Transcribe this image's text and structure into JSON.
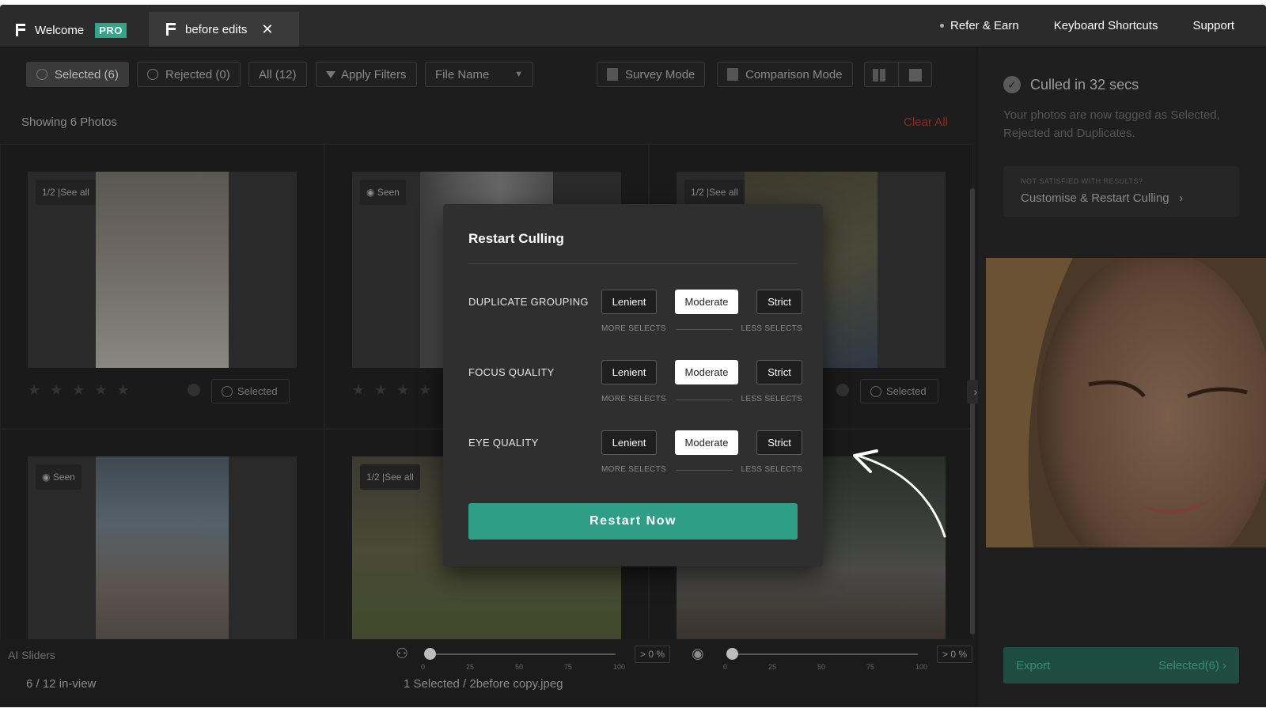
{
  "tabs": [
    {
      "label": "Welcome",
      "badge": "PRO"
    },
    {
      "label": "before edits",
      "close": "✕"
    }
  ],
  "top_links": {
    "refer": "Refer & Earn",
    "shortcuts": "Keyboard Shortcuts",
    "support": "Support"
  },
  "toolbar": {
    "selected": "Selected (6)",
    "rejected": "Rejected (0)",
    "all": "All (12)",
    "filters": "Apply Filters",
    "sort_value": "File Name",
    "survey": "Survey Mode",
    "comparison": "Comparison Mode"
  },
  "gallery": {
    "showing": "Showing 6 Photos",
    "clear_all": "Clear All",
    "badge_group": "1/2 |See all",
    "badge_seen": "Seen",
    "selected_label": "Selected"
  },
  "bottom": {
    "ai_label": "AI Sliders",
    "in_view": "6 / 12 in-view",
    "selection_info": "1 Selected / 2before copy.jpeg",
    "ticks": [
      "0",
      "25",
      "50",
      "75",
      "100"
    ],
    "pct1": "> 0 %",
    "pct2": "> 0 %"
  },
  "right_panel": {
    "title": "Culled in 32 secs",
    "desc": "Your photos are now tagged as Selected, Rejected and Duplicates.",
    "box_small": "NOT SATISFIED WITH RESULTS?",
    "box_big": "Customise & Restart Culling",
    "export": "Export",
    "export_count": "Selected(6)"
  },
  "modal": {
    "title": "Restart Culling",
    "rows": [
      {
        "label": "DUPLICATE GROUPING",
        "options": [
          "Lenient",
          "Moderate",
          "Strict"
        ],
        "selected": "Moderate"
      },
      {
        "label": "FOCUS QUALITY",
        "options": [
          "Lenient",
          "Moderate",
          "Strict"
        ],
        "selected": "Moderate"
      },
      {
        "label": "EYE QUALITY",
        "options": [
          "Lenient",
          "Moderate",
          "Strict"
        ],
        "selected": "Moderate"
      }
    ],
    "more": "MORE SELECTS",
    "less": "LESS SELECTS",
    "button": "Restart Now"
  },
  "colors": {
    "accent": "#2f9e86",
    "pro": "#2fa58a",
    "clear": "#8b2a26"
  }
}
